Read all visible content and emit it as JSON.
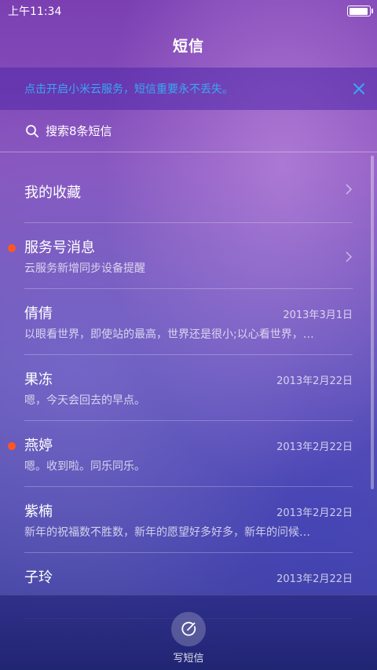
{
  "status_bar": {
    "time": "上午11:34",
    "battery_level": 0.95
  },
  "header": {
    "title": "短信"
  },
  "banner": {
    "text": "点击开启小米云服务，短信重要永不丢失。",
    "close_icon": "close-icon"
  },
  "search": {
    "text": "搜索8条短信",
    "icon": "search-icon"
  },
  "favorites": {
    "label": "我的收藏",
    "icon": "chevron-right-icon"
  },
  "service": {
    "name": "服务号消息",
    "preview": "云服务新增同步设备提醒",
    "unread": true,
    "icon": "chevron-right-icon"
  },
  "conversations": [
    {
      "name": "倩倩",
      "date": "2013年3月1日",
      "preview": "以眼看世界，即使站的最高，世界还是很小;以心看世界，…",
      "unread": false
    },
    {
      "name": "果冻",
      "date": "2013年2月22日",
      "preview": "嗯，今天会回去的早点。",
      "unread": false
    },
    {
      "name": "燕婷",
      "date": "2013年2月22日",
      "preview": "嗯。收到啦。同乐同乐。",
      "unread": true
    },
    {
      "name": "紫楠",
      "date": "2013年2月22日",
      "preview": "新年的祝福数不胜数，新年的愿望好多好多，新年的问候…",
      "unread": false
    },
    {
      "name": "子玲",
      "date": "2013年2月22日",
      "preview": "",
      "unread": false
    }
  ],
  "bottom": {
    "compose_label": "写短信",
    "compose_icon": "compose-icon"
  },
  "colors": {
    "accent_dot": "#ff5722",
    "banner_text": "#3aa7f2"
  }
}
